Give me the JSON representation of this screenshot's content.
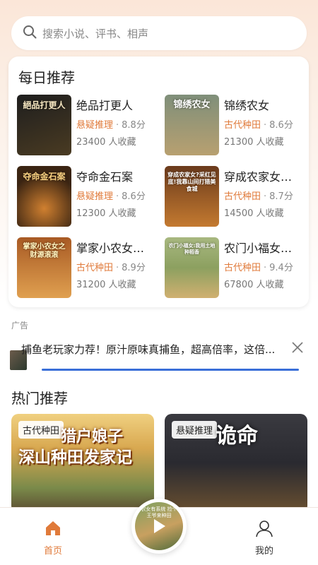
{
  "search": {
    "placeholder": "搜索小说、评书、相声",
    "icon": "search-icon"
  },
  "daily": {
    "title": "每日推荐",
    "books": [
      {
        "name": "绝品打更人",
        "category": "悬疑推理",
        "score": "8.8分",
        "favorites": "23400 人收藏",
        "cover_text": "絕品打更人",
        "cover_colors": [
          "#2b2b2b",
          "#4a3b22"
        ]
      },
      {
        "name": "锦绣农女",
        "category": "古代种田",
        "score": "8.6分",
        "favorites": "21300 人收藏",
        "cover_text": "锦绣农女",
        "cover_colors": [
          "#7f8f7a",
          "#b8a070"
        ]
      },
      {
        "name": "夺命金石案",
        "category": "悬疑推理",
        "score": "8.6分",
        "favorites": "12300 人收藏",
        "cover_text": "夺命金石案",
        "cover_colors": [
          "#3a2412",
          "#a05a20"
        ]
      },
      {
        "name": "穿成农家女…",
        "category": "古代种田",
        "score": "8.7分",
        "favorites": "14500 人收藏",
        "cover_text": "穿成农家女?采红见底!我靠山间打猎美食城",
        "cover_colors": [
          "#6a3a1c",
          "#c47a30"
        ]
      },
      {
        "name": "掌家小农女…",
        "category": "古代种田",
        "score": "8.9分",
        "favorites": "31200 人收藏",
        "cover_text": "掌家小农女之财源滚滚",
        "cover_colors": [
          "#a85a24",
          "#e0a050"
        ]
      },
      {
        "name": "农门小福女…",
        "category": "古代种田",
        "score": "9.4分",
        "favorites": "67800 人收藏",
        "cover_text": "农门小福女:我用土地种稻香",
        "cover_colors": [
          "#8ca060",
          "#d0b070"
        ]
      }
    ],
    "separator": "·"
  },
  "ad": {
    "label": "广告",
    "text": "捕鱼老玩家力荐！原汁原味真捕鱼，超高倍率，这倍...",
    "close_icon": "close-icon"
  },
  "hot": {
    "title": "热门推荐",
    "cards": [
      {
        "tag": "古代种田",
        "title_line1": "猎户娘子",
        "title_line2": "深山种田发家记",
        "colors": [
          "#e8c070",
          "#6a8a4a"
        ]
      },
      {
        "tag": "悬疑推理",
        "title_line1": "诡命",
        "colors": [
          "#2a2a30",
          "#5a4a3a"
        ]
      }
    ]
  },
  "tabbar": {
    "home": {
      "label": "首页",
      "icon": "home-icon",
      "color": "#e07a3a"
    },
    "player": {
      "icon": "play-icon",
      "disc_text": "农女有系统 捡个王爷来种田"
    },
    "mine": {
      "label": "我的",
      "icon": "user-icon",
      "color": "#333333"
    }
  }
}
